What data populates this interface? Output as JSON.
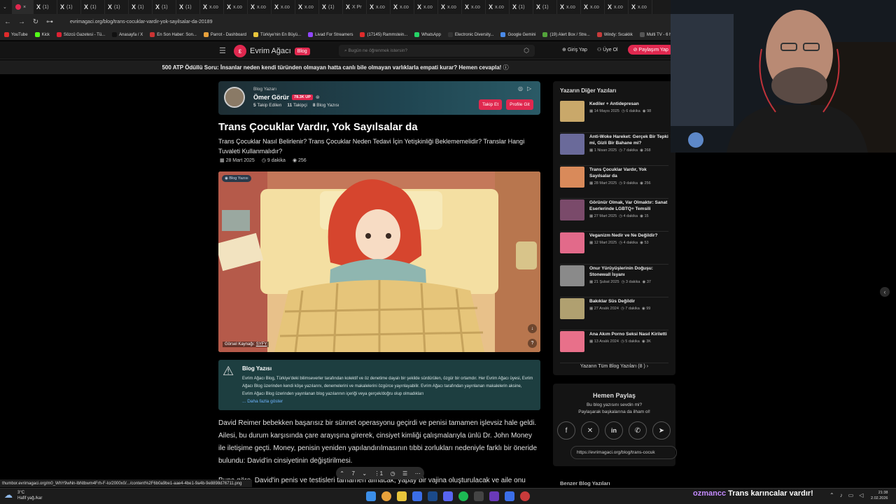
{
  "browser": {
    "tabs": [
      "(1)",
      "(1)",
      "(1)",
      "(1)",
      "(1)",
      "(1)",
      "(1)",
      "x.co",
      "x.co",
      "x.co",
      "x.co",
      "x.co",
      "(1)",
      "X Pr",
      "x.co",
      "x.co",
      "x.co",
      "x.co",
      "x.co",
      "x.co",
      "(1)",
      "(1)",
      "x.co",
      "x.co",
      "x.co",
      "x.co"
    ],
    "url": "evrimagaci.org/blog/trans-cocuklar-vardir-yok-sayilsalar-da-20189",
    "bookmarks": [
      "YouTube",
      "Kick",
      "Sözcü Gazetesi - Tü...",
      "Anasayfa / X",
      "En Son Haber: Son...",
      "Parrot - Dashboard",
      "Türkiye'nin En Büyü...",
      "Livad For Streamers",
      "(17145) Rammstein...",
      "WhatsApp",
      "Electronic Diversity...",
      "Google Gemini",
      "(19) Alert Box / Stre...",
      "Windy: Sıcaklık",
      "Multi TV - 6 haber"
    ]
  },
  "site": {
    "logo_text": "Evrim Ağacı",
    "logo_badge": "Blog",
    "search_placeholder": "Bugün ne öğrenmek istersin?",
    "login": "Giriş Yap",
    "signup": "Üye Ol",
    "share": "Paylaşım Yap",
    "announcement": "500 ATP Ödüllü Soru: İnsanlar neden kendi türünden olmayan hatta canlı bile olmayan varlıklarla empati kurar? Hemen cevapla!"
  },
  "author": {
    "role": "Blog Yazarı",
    "name": "Ömer Görür",
    "up_badge": "78.3K UP",
    "following": "5",
    "following_label": "Takip Edilen",
    "followers": "11",
    "followers_label": "Takipçi",
    "posts": "8",
    "posts_label": "Blog Yazısı",
    "follow_btn": "Takip Et",
    "profile_btn": "Profile Git"
  },
  "article": {
    "title": "Trans Çocuklar Vardır, Yok Sayılsalar da",
    "subtitle": "Trans Çocuklar Nasıl Belirlenir? Trans Çocuklar Neden Tedavi İçin Yetişkinliği Beklememelidir? Translar Hangi Tuvaleti Kullanmalıdır?",
    "date": "28 Mart 2025",
    "read_time": "9 dakika",
    "views": "256",
    "hero_badge": "Blog Yazısı",
    "image_source_label": "Görsel Kaynağı:",
    "image_source": "SYFY",
    "notice_title": "Blog Yazısı",
    "notice_body": "Evrim Ağacı Blog, Türkiye'deki bilimseverler tarafından kolektif ve öz denetime dayalı bir şekilde sürdürülen, özgür bir ortamdır. Her Evrim Ağacı üyesi, Evrim Ağacı Blog üzerinden kendi köşe yazılarını, denemelerini ve makalelerini özgürce yayınlayabilir. Evrim Ağacı tarafından yayınlanan makalelerin aksine, Evrim Ağacı Blog üzerinden yayınlanan blog yazılarının içeriği veya gerçek/doğru olup olmadıkları",
    "notice_more": "... Daha fazla göster",
    "paragraph1": "David Reimer bebekken başarısız bir sünnet operasyonu geçirdi ve penisi tamamen işlevsiz hale geldi. Ailesi, bu durum karşısında çare arayışına girerek, cinsiyet kimliği çalışmalarıyla ünlü Dr. John Money ile iletişime geçti. Money, penisin yeniden yapılandırılmasının tıbbi zorlukları nedeniyle farklı bir öneride bulundu: David'in cinsiyetinin değiştirilmesi.",
    "paragraph2_fragment": "Buna göre, David'in penis ve testisleri tamamen alınacak, yapay bir vajina oluşturulacak ve aile onu"
  },
  "sidebar": {
    "title": "Yazarın Diğer Yazıları",
    "posts": [
      {
        "title": "Kediler + Antidepresan",
        "date": "14 Mayıs 2025",
        "time": "6 dakika",
        "views": "98",
        "color": "#c9a86a"
      },
      {
        "title": "Anti-Woke Hareket: Gerçek Bir Tepki mi, Gizli Bir Bahane mi?",
        "date": "1 Nisan 2025",
        "time": "7 dakika",
        "views": "268",
        "color": "#6a6a9a"
      },
      {
        "title": "Trans Çocuklar Vardır, Yok Sayılsalar da",
        "date": "28 Mart 2025",
        "time": "9 dakika",
        "views": "256",
        "color": "#d98a5a"
      },
      {
        "title": "Görünür Olmak, Var Olmaktır: Sanat Eserlerinde LGBTQ+ Temsili",
        "date": "27 Mart 2025",
        "time": "4 dakika",
        "views": "15",
        "color": "#7a4a6a"
      },
      {
        "title": "Veganizm Nedir ve Ne Değildir?",
        "date": "12 Mart 2025",
        "time": "4 dakika",
        "views": "53",
        "color": "#e26a8a"
      },
      {
        "title": "Onur Yürüyüşlerinin Doğuşu: Stonewall İsyanı",
        "date": "21 Şubat 2025",
        "time": "3 dakika",
        "views": "37",
        "color": "#8a8a8a"
      },
      {
        "title": "Bakıklar Süs Değildir",
        "date": "27 Aralık 2024",
        "time": "7 dakika",
        "views": "99",
        "color": "#b0a070"
      },
      {
        "title": "Ana Akım Porno Seksi Nasıl Kiriletti",
        "date": "13 Aralık 2024",
        "time": "5 dakika",
        "views": "3K",
        "color": "#e8708a"
      }
    ],
    "all_posts": "Yazarın Tüm Blog Yazıları (8 )"
  },
  "share_box": {
    "title": "Hemen Paylaş",
    "line1": "Bu blog yazısını sevdin mi?",
    "line2": "Paylaşarak başkalarına da ilham ol!",
    "url": "https://evrimagaci.org/blog/trans-cocuk"
  },
  "similar_title": "Benzer Blog Yazıları",
  "status_url": "thumbor.evrimagaci.org/m0_WhY9wNn-lbNtbwm4Frh-F-Io/2000x0/.../content%2F6b0a9be1-aae4-4be1-9a4b-9e8898d76711.png",
  "float_toolbar": {
    "count": "7",
    "tabs": "1"
  },
  "taskbar": {
    "weather_temp": "3°C",
    "weather_desc": "Hafif yağ./kar",
    "time": "21:38",
    "date": "2.02.2026"
  },
  "chat": {
    "user": "ozmancc",
    "message": "Trans karıncalar vardır!"
  }
}
